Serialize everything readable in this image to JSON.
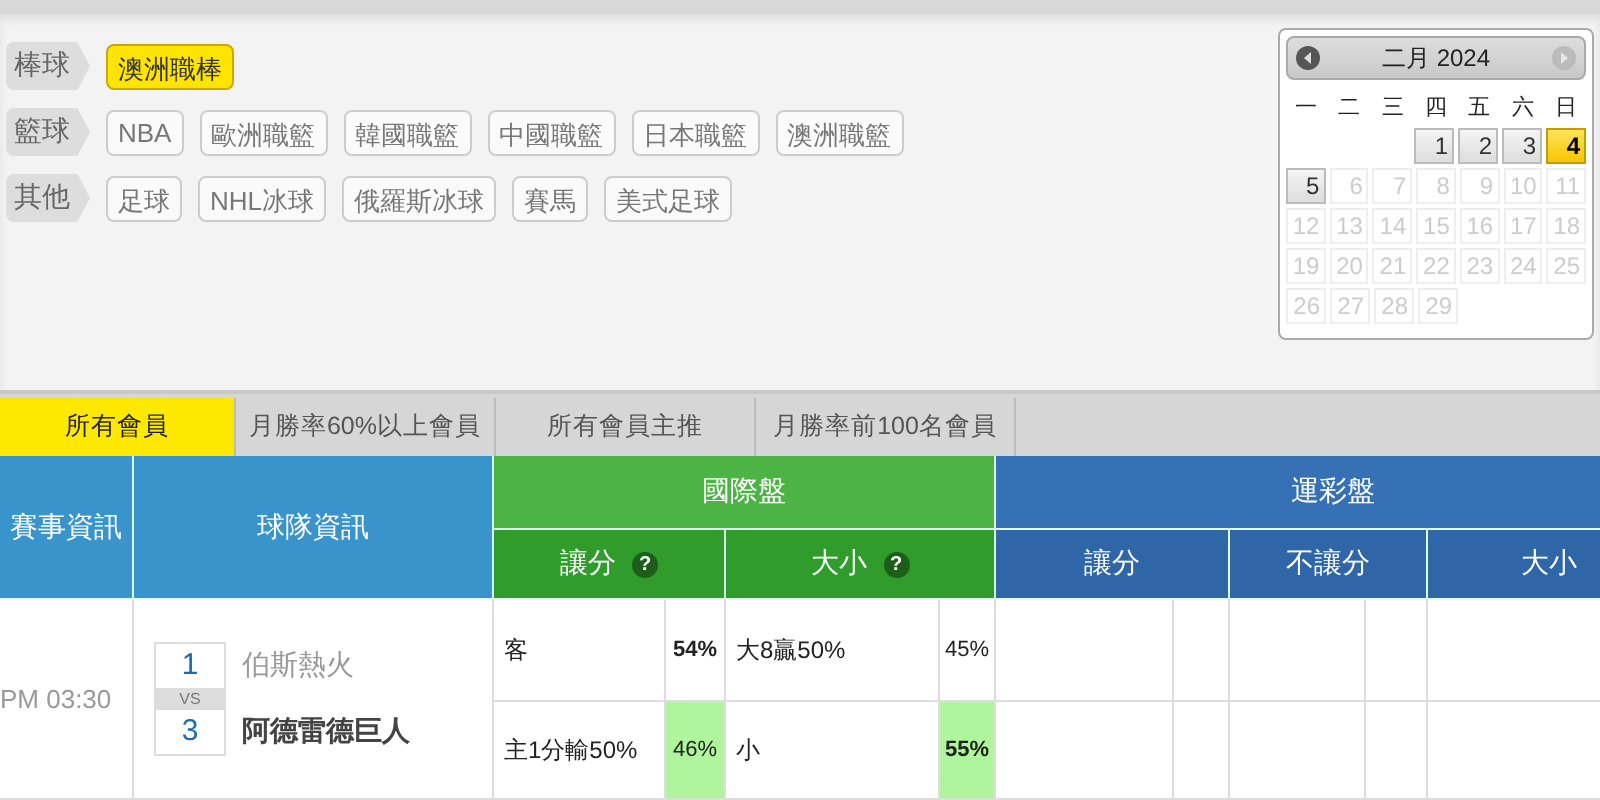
{
  "categories": [
    {
      "label": "棒球",
      "chips": [
        {
          "label": "澳洲職棒",
          "selected": true
        }
      ]
    },
    {
      "label": "籃球",
      "chips": [
        {
          "label": "NBA",
          "selected": false
        },
        {
          "label": "歐洲職籃",
          "selected": false
        },
        {
          "label": "韓國職籃",
          "selected": false
        },
        {
          "label": "中國職籃",
          "selected": false
        },
        {
          "label": "日本職籃",
          "selected": false
        },
        {
          "label": "澳洲職籃",
          "selected": false
        }
      ]
    },
    {
      "label": "其他",
      "chips": [
        {
          "label": "足球",
          "selected": false
        },
        {
          "label": "NHL冰球",
          "selected": false
        },
        {
          "label": "俄羅斯冰球",
          "selected": false
        },
        {
          "label": "賽馬",
          "selected": false
        },
        {
          "label": "美式足球",
          "selected": false
        }
      ]
    }
  ],
  "calendar": {
    "title": "二月 2024",
    "next_disabled": true,
    "weekdays": [
      "一",
      "二",
      "三",
      "四",
      "五",
      "六",
      "日"
    ],
    "weeks": [
      {
        "days": [
          {
            "day": "1",
            "selected": false,
            "disabled": false
          },
          {
            "day": "2",
            "selected": false,
            "disabled": false
          },
          {
            "day": "3",
            "selected": false,
            "disabled": false
          },
          {
            "day": "4",
            "selected": true,
            "disabled": false
          }
        ]
      },
      {
        "days": [
          {
            "day": "5",
            "selected": false,
            "disabled": false
          },
          {
            "day": "6",
            "selected": false,
            "disabled": true
          },
          {
            "day": "7",
            "selected": false,
            "disabled": true
          },
          {
            "day": "8",
            "selected": false,
            "disabled": true
          },
          {
            "day": "9",
            "selected": false,
            "disabled": true
          },
          {
            "day": "10",
            "selected": false,
            "disabled": true
          },
          {
            "day": "11",
            "selected": false,
            "disabled": true
          }
        ]
      },
      {
        "days": [
          {
            "day": "12",
            "selected": false,
            "disabled": true
          },
          {
            "day": "13",
            "selected": false,
            "disabled": true
          },
          {
            "day": "14",
            "selected": false,
            "disabled": true
          },
          {
            "day": "15",
            "selected": false,
            "disabled": true
          },
          {
            "day": "16",
            "selected": false,
            "disabled": true
          },
          {
            "day": "17",
            "selected": false,
            "disabled": true
          },
          {
            "day": "18",
            "selected": false,
            "disabled": true
          }
        ]
      },
      {
        "days": [
          {
            "day": "19",
            "selected": false,
            "disabled": true
          },
          {
            "day": "20",
            "selected": false,
            "disabled": true
          },
          {
            "day": "21",
            "selected": false,
            "disabled": true
          },
          {
            "day": "22",
            "selected": false,
            "disabled": true
          },
          {
            "day": "23",
            "selected": false,
            "disabled": true
          },
          {
            "day": "24",
            "selected": false,
            "disabled": true
          },
          {
            "day": "25",
            "selected": false,
            "disabled": true
          }
        ]
      },
      {
        "days": [
          {
            "day": "26",
            "selected": false,
            "disabled": true
          },
          {
            "day": "27",
            "selected": false,
            "disabled": true
          },
          {
            "day": "28",
            "selected": false,
            "disabled": true
          },
          {
            "day": "29",
            "selected": false,
            "disabled": true
          }
        ]
      }
    ]
  },
  "tabs": [
    {
      "label": "所有會員",
      "selected": true
    },
    {
      "label": "月勝率60%以上會員",
      "selected": false
    },
    {
      "label": "所有會員主推",
      "selected": false
    },
    {
      "label": "月勝率前100名會員",
      "selected": false
    }
  ],
  "table": {
    "col_event": "賽事資訊",
    "col_team": "球隊資訊",
    "intl": {
      "title": "國際盤",
      "spread": "讓分",
      "spread_help": "?",
      "total": "大小",
      "total_help": "?"
    },
    "lottery": {
      "title": "運彩盤",
      "spread": "讓分",
      "no_spread": "不讓分",
      "total": "大小"
    },
    "game": {
      "time": "PM 03:30",
      "teams": [
        {
          "seed": "1",
          "name": "伯斯熱火",
          "bold": false
        },
        {
          "seed": "3",
          "name": "阿德雷德巨人",
          "bold": true
        }
      ],
      "vs": "VS"
    },
    "rows": [
      {
        "spread_text": "客",
        "spread_pct": {
          "value": "54%",
          "bold": true,
          "highlight": false
        },
        "total_text": "大8贏50%",
        "total_pct": {
          "value": "45%",
          "bold": false,
          "highlight": false
        }
      },
      {
        "spread_text": "主1分輸50%",
        "spread_pct": {
          "value": "46%",
          "bold": false,
          "highlight": true
        },
        "total_text": "小",
        "total_pct": {
          "value": "55%",
          "bold": true,
          "highlight": true
        }
      }
    ]
  }
}
